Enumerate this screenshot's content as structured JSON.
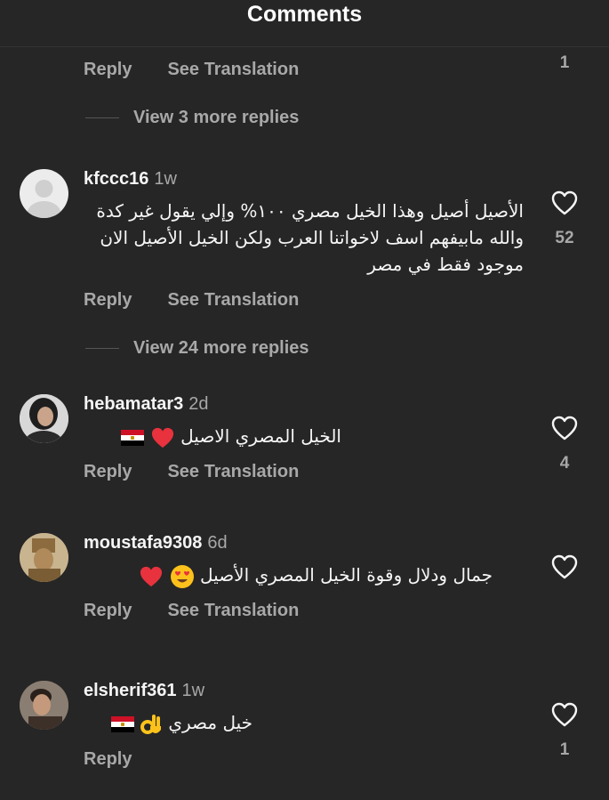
{
  "header": {
    "title": "Comments"
  },
  "labels": {
    "reply": "Reply",
    "see_translation": "See Translation"
  },
  "top_fragment": {
    "like_count": "1"
  },
  "view_more_1": "View 3 more replies",
  "view_more_2": "View 24 more replies",
  "comments": [
    {
      "username": "kfccc16",
      "time": "1w",
      "text": "الأصيل أصيل وهذا الخيل مصري ١٠٠% وإلي يقول غير كدة والله مابيفهم اسف لاخواتنا العرب ولكن الخيل الأصيل الان موجود فقط في مصر",
      "like_count": "52",
      "avatar": "default-avatar-icon"
    },
    {
      "username": "hebamatar3",
      "time": "2d",
      "text": "الخيل المصري الاصيل",
      "like_count": "4",
      "avatar": "profile-photo"
    },
    {
      "username": "moustafa9308",
      "time": "6d",
      "text": "جمال ودلال وقوة الخيل المصري الأصيل",
      "like_count": "",
      "avatar": "profile-photo"
    },
    {
      "username": "elsherif361",
      "time": "1w",
      "text": "خيل مصري",
      "like_count": "1",
      "avatar": "profile-photo"
    }
  ],
  "colors": {
    "background": "#262626",
    "secondary_text": "#a8a8a8",
    "primary_text": "#f5f5f5",
    "heart_red": "#e8323d"
  }
}
